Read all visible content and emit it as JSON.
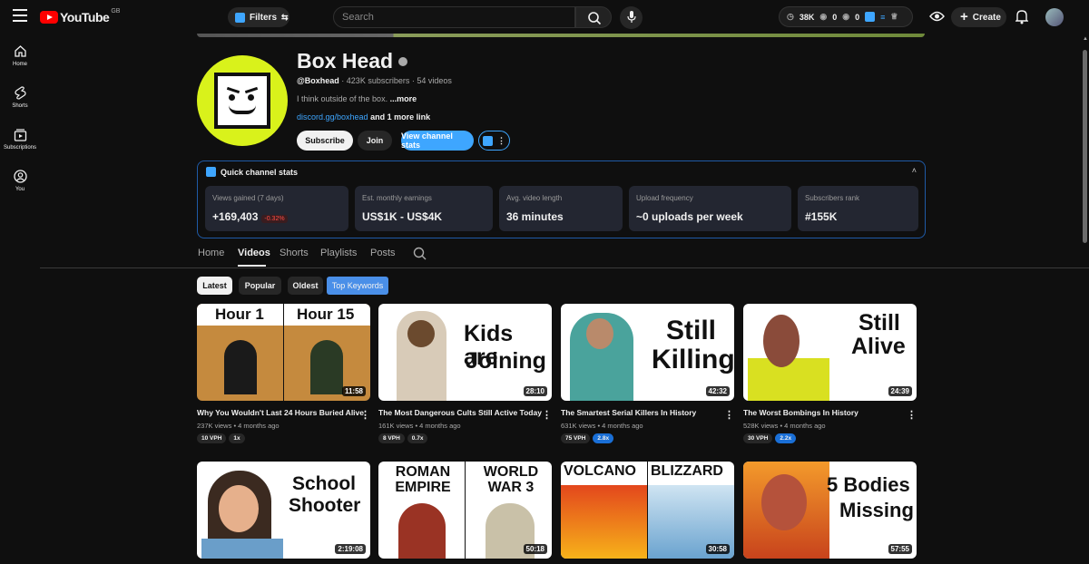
{
  "topbar": {
    "logo_text": "YouTube",
    "region": "GB",
    "filters_label": "Filters",
    "search_placeholder": "Search",
    "stats": {
      "views": "38K",
      "likes": "0",
      "other": "0"
    },
    "create_label": "Create"
  },
  "nav": [
    {
      "label": "Home",
      "icon": "home-icon"
    },
    {
      "label": "Shorts",
      "icon": "shorts-icon"
    },
    {
      "label": "Subscriptions",
      "icon": "subscriptions-icon"
    },
    {
      "label": "You",
      "icon": "you-icon"
    }
  ],
  "channel": {
    "name": "Box Head",
    "handle": "@Boxhead",
    "subscribers": "423K subscribers",
    "videos": "54 videos",
    "description": "I think outside of the box.",
    "more": "...more",
    "link": "discord.gg/boxhead",
    "more_links": "and 1 more link",
    "subscribe_label": "Subscribe",
    "join_label": "Join",
    "view_stats_label": "View channel stats"
  },
  "quick_stats": {
    "title": "Quick channel stats",
    "cards": [
      {
        "label": "Views gained (7 days)",
        "value": "+169,403",
        "change": "-0.32%"
      },
      {
        "label": "Est. monthly earnings",
        "value": "US$1K - US$4K"
      },
      {
        "label": "Avg. video length",
        "value": "36 minutes"
      },
      {
        "label": "Upload frequency",
        "value": "~0 uploads per week"
      },
      {
        "label": "Subscribers rank",
        "value": "#155K"
      }
    ]
  },
  "tabs": [
    "Home",
    "Videos",
    "Shorts",
    "Playlists",
    "Posts"
  ],
  "active_tab": "Videos",
  "chips": [
    "Latest",
    "Popular",
    "Oldest",
    "Top Keywords"
  ],
  "videos": [
    {
      "title": "Why You Wouldn't Last 24 Hours Buried Alive",
      "views": "237K views",
      "age": "4 months ago",
      "vph": "10 VPH",
      "mult": "1x",
      "duration": "11:58",
      "thumb_text": [
        "Hour 1",
        "Hour 15"
      ],
      "thumb_bg": "#c58a3e"
    },
    {
      "title": "The Most Dangerous Cults Still Active Today",
      "views": "161K views",
      "age": "4 months ago",
      "vph": "8 VPH",
      "mult": "0.7x",
      "duration": "28:10",
      "thumb_text": [
        "Kids are",
        "Joining"
      ],
      "thumb_bg": "#ffffff"
    },
    {
      "title": "The Smartest Serial Killers In History",
      "views": "631K views",
      "age": "4 months ago",
      "vph": "75 VPH",
      "mult": "2.8x",
      "duration": "42:32",
      "thumb_text": [
        "Still",
        "Killing"
      ],
      "thumb_bg": "#ffffff"
    },
    {
      "title": "The Worst Bombings In History",
      "views": "528K views",
      "age": "4 months ago",
      "vph": "30 VPH",
      "mult": "2.2x",
      "duration": "24:39",
      "thumb_text": [
        "Still",
        "Alive"
      ],
      "thumb_bg": "#ffffff"
    },
    {
      "title": "",
      "duration": "2:19:08",
      "thumb_text": [
        "School",
        "Shooter"
      ],
      "thumb_bg": "#ffffff"
    },
    {
      "title": "",
      "duration": "50:18",
      "thumb_text": [
        "ROMAN EMPIRE",
        "WORLD WAR 3"
      ],
      "thumb_bg": "#ffffff"
    },
    {
      "title": "",
      "duration": "30:58",
      "thumb_text": [
        "VOLCANO",
        "BLIZZARD"
      ],
      "thumb_bg": "#ffffff"
    },
    {
      "title": "",
      "duration": "57:55",
      "thumb_text": [
        "5 Bodies",
        "Missing"
      ],
      "thumb_bg": "#ffffff"
    }
  ],
  "colors": {
    "accent": "#3ea6ff",
    "brand": "#ff0000",
    "avatar_bg": "#d9f21b",
    "panel_border": "#1f5aa6"
  }
}
